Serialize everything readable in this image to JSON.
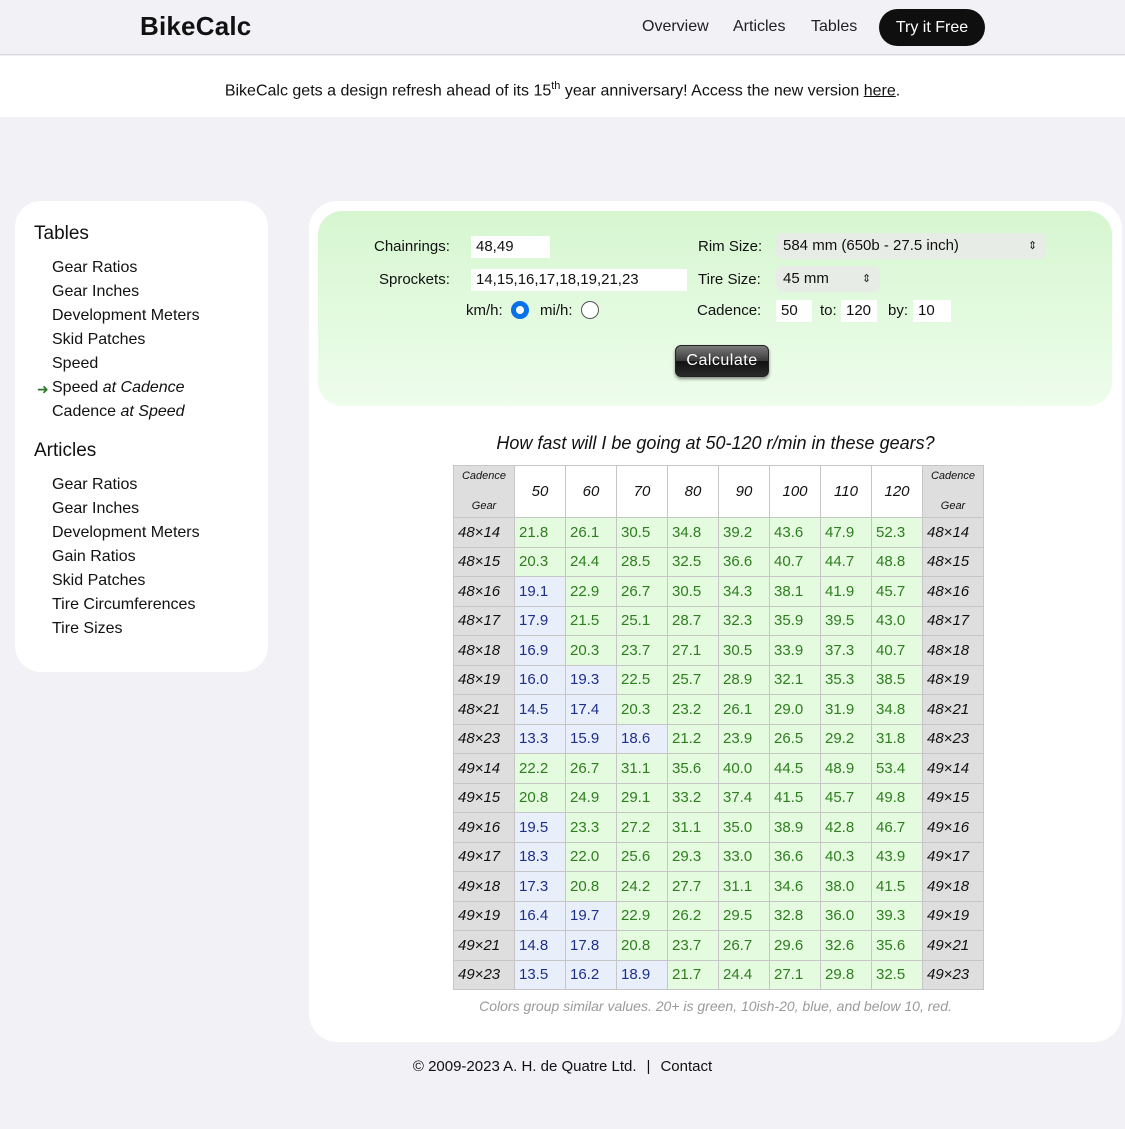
{
  "brand": "BikeCalc",
  "nav": {
    "overview": "Overview",
    "articles": "Articles",
    "tables": "Tables",
    "cta": "Try it Free"
  },
  "banner": {
    "prefix": "BikeCalc gets a design refresh ahead of its 15",
    "sup": "th",
    "middle": " year anniversary! Access the new version ",
    "link": "here",
    "suffix": "."
  },
  "sidebar": {
    "tables_heading": "Tables",
    "tables": [
      "Gear Ratios",
      "Gear Inches",
      "Development Meters",
      "Skid Patches",
      "Speed"
    ],
    "speed_at_cadence": {
      "a": "Speed ",
      "b": "at",
      "c": " Cadence"
    },
    "cadence_at_speed": {
      "a": "Cadence ",
      "b": "at",
      "c": " Speed"
    },
    "articles_heading": "Articles",
    "articles": [
      "Gear Ratios",
      "Gear Inches",
      "Development Meters",
      "Gain Ratios",
      "Skid Patches",
      "Tire Circumferences",
      "Tire Sizes"
    ]
  },
  "form": {
    "chainrings_label": "Chainrings:",
    "chainrings_value": "48,49",
    "sprockets_label": "Sprockets:",
    "sprockets_value": "14,15,16,17,18,19,21,23",
    "kmh_label": "km/h:",
    "mih_label": "mi/h:",
    "rim_label": "Rim Size:",
    "rim_value": "584 mm (650b - 27.5 inch)",
    "tire_label": "Tire Size:",
    "tire_value": "45 mm",
    "cadence_label": "Cadence:",
    "cadence_value": "50",
    "to_label": "to:",
    "to_value": "120",
    "by_label": "by:",
    "by_value": "10",
    "calculate": "Calculate"
  },
  "question": "How fast will I be going at 50-120 r/min in these gears?",
  "table": {
    "corner_top": "Cadence",
    "corner_bottom": "Gear",
    "cadences": [
      "50",
      "60",
      "70",
      "80",
      "90",
      "100",
      "110",
      "120"
    ],
    "rows": [
      {
        "gear": "48×14",
        "values": [
          "21.8",
          "26.1",
          "30.5",
          "34.8",
          "39.2",
          "43.6",
          "47.9",
          "52.3"
        ]
      },
      {
        "gear": "48×15",
        "values": [
          "20.3",
          "24.4",
          "28.5",
          "32.5",
          "36.6",
          "40.7",
          "44.7",
          "48.8"
        ]
      },
      {
        "gear": "48×16",
        "values": [
          "19.1",
          "22.9",
          "26.7",
          "30.5",
          "34.3",
          "38.1",
          "41.9",
          "45.7"
        ]
      },
      {
        "gear": "48×17",
        "values": [
          "17.9",
          "21.5",
          "25.1",
          "28.7",
          "32.3",
          "35.9",
          "39.5",
          "43.0"
        ]
      },
      {
        "gear": "48×18",
        "values": [
          "16.9",
          "20.3",
          "23.7",
          "27.1",
          "30.5",
          "33.9",
          "37.3",
          "40.7"
        ]
      },
      {
        "gear": "48×19",
        "values": [
          "16.0",
          "19.3",
          "22.5",
          "25.7",
          "28.9",
          "32.1",
          "35.3",
          "38.5"
        ]
      },
      {
        "gear": "48×21",
        "values": [
          "14.5",
          "17.4",
          "20.3",
          "23.2",
          "26.1",
          "29.0",
          "31.9",
          "34.8"
        ]
      },
      {
        "gear": "48×23",
        "values": [
          "13.3",
          "15.9",
          "18.6",
          "21.2",
          "23.9",
          "26.5",
          "29.2",
          "31.8"
        ]
      },
      {
        "gear": "49×14",
        "values": [
          "22.2",
          "26.7",
          "31.1",
          "35.6",
          "40.0",
          "44.5",
          "48.9",
          "53.4"
        ]
      },
      {
        "gear": "49×15",
        "values": [
          "20.8",
          "24.9",
          "29.1",
          "33.2",
          "37.4",
          "41.5",
          "45.7",
          "49.8"
        ]
      },
      {
        "gear": "49×16",
        "values": [
          "19.5",
          "23.3",
          "27.2",
          "31.1",
          "35.0",
          "38.9",
          "42.8",
          "46.7"
        ]
      },
      {
        "gear": "49×17",
        "values": [
          "18.3",
          "22.0",
          "25.6",
          "29.3",
          "33.0",
          "36.6",
          "40.3",
          "43.9"
        ]
      },
      {
        "gear": "49×18",
        "values": [
          "17.3",
          "20.8",
          "24.2",
          "27.7",
          "31.1",
          "34.6",
          "38.0",
          "41.5"
        ]
      },
      {
        "gear": "49×19",
        "values": [
          "16.4",
          "19.7",
          "22.9",
          "26.2",
          "29.5",
          "32.8",
          "36.0",
          "39.3"
        ]
      },
      {
        "gear": "49×21",
        "values": [
          "14.8",
          "17.8",
          "20.8",
          "23.7",
          "26.7",
          "29.6",
          "32.6",
          "35.6"
        ]
      },
      {
        "gear": "49×23",
        "values": [
          "13.5",
          "16.2",
          "18.9",
          "21.7",
          "24.4",
          "27.1",
          "29.8",
          "32.5"
        ]
      }
    ]
  },
  "note": "Colors group similar values. 20+ is green, 10ish-20, blue, and below 10, red.",
  "footer": {
    "copyright": "© 2009-2023 A. H. de Quatre Ltd.",
    "separator": "|",
    "contact": "Contact"
  },
  "colors": {
    "green_text": "#2e7d1f",
    "green_bg": "#e5fbe0",
    "blue_text": "#1d2f8a",
    "blue_bg": "#e9eefb",
    "radio_accent": "#0a72e8"
  }
}
